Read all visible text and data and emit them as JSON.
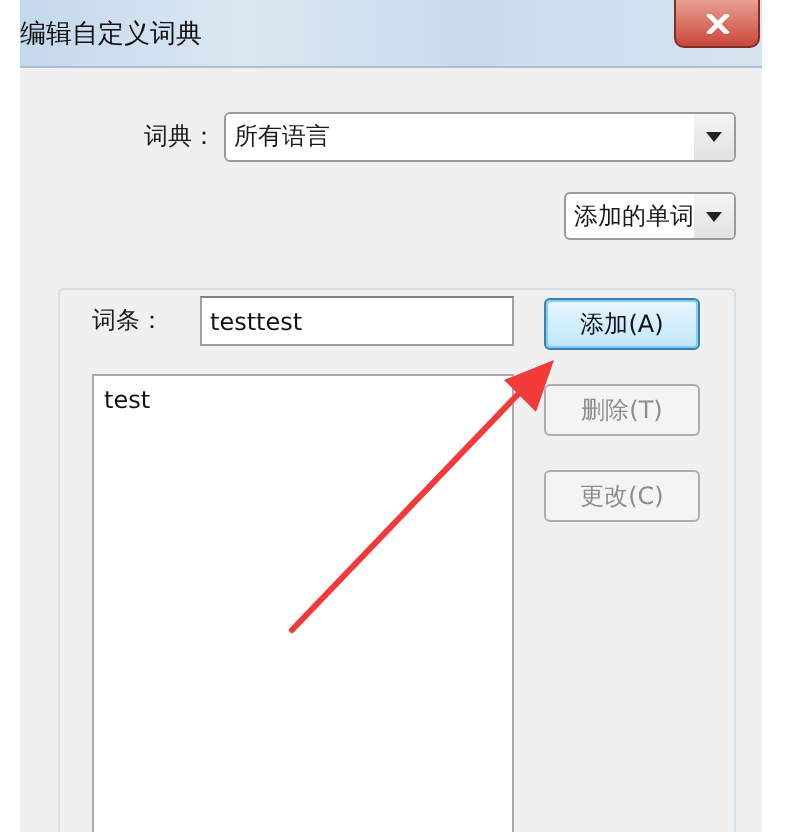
{
  "window": {
    "title": "编辑自定义词典"
  },
  "dictionary": {
    "label": "词典：",
    "value": "所有语言"
  },
  "filter": {
    "value": "添加的单词"
  },
  "entry": {
    "label": "词条：",
    "value": "testtest"
  },
  "words": [
    {
      "text": "test",
      "selected": false
    }
  ],
  "buttons": [
    {
      "label": "添加(A)",
      "disabled": false,
      "focused": true
    },
    {
      "label": "删除(T)",
      "disabled": true,
      "focused": false
    },
    {
      "label": "更改(C)",
      "disabled": true,
      "focused": false
    }
  ]
}
